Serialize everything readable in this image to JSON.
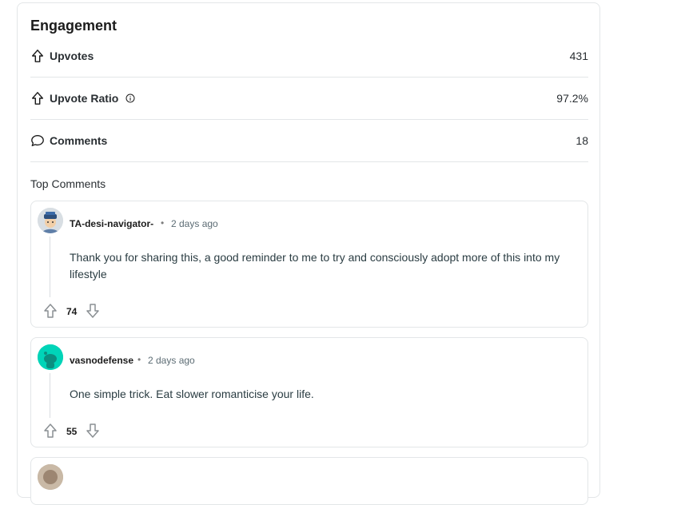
{
  "engagement": {
    "title": "Engagement",
    "metrics": [
      {
        "label": "Upvotes",
        "value": "431",
        "icon": "upvote-arrow-icon"
      },
      {
        "label": "Upvote Ratio",
        "value": "97.2%",
        "icon": "upvote-arrow-icon"
      },
      {
        "label": "Comments",
        "value": "18",
        "icon": "comment-bubble-icon"
      }
    ]
  },
  "top_comments": {
    "label": "Top Comments",
    "items": [
      {
        "author": "TA-desi-navigator-",
        "time": "2 days ago",
        "text": "Thank you for sharing this, a good reminder to me to try and consciously adopt more of this into my lifestyle",
        "votes": "74"
      },
      {
        "author": "vasnodefense",
        "time": "2 days ago",
        "text": "One simple trick. Eat slower romanticise your life.",
        "votes": "55"
      }
    ]
  },
  "colors": {
    "avatar2": "#00d4b8",
    "border": "#e3e6e8"
  }
}
